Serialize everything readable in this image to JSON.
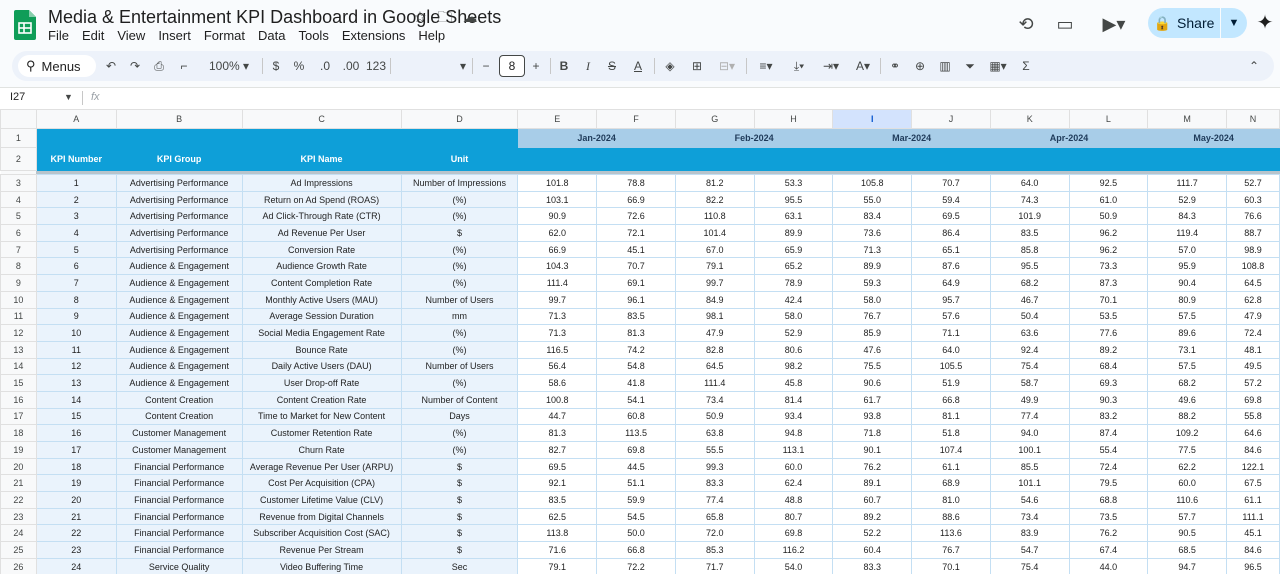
{
  "doc": {
    "title": "Media & Entertainment KPI Dashboard in Google Sheets",
    "menus": [
      "File",
      "Edit",
      "View",
      "Insert",
      "Format",
      "Data",
      "Tools",
      "Extensions",
      "Help"
    ],
    "share_label": "Share"
  },
  "toolbar": {
    "search_label": "Menus",
    "zoom": "100%",
    "currency": "$",
    "percent": "%",
    "dec_decrease": ".0",
    "dec_increase": ".00",
    "format_123": "123",
    "font_size": "8",
    "bold": "B",
    "strike": "S",
    "text_color": "A",
    "minus": "−",
    "plus": "+"
  },
  "formula_bar": {
    "cell_ref": "I27",
    "fx": "fx"
  },
  "columns": [
    "A",
    "B",
    "C",
    "D",
    "E",
    "F",
    "G",
    "H",
    "I",
    "J",
    "K",
    "L",
    "M",
    "N"
  ],
  "selected_column": "I",
  "header_row1": {
    "months": [
      "Jan-2024",
      "Feb-2024",
      "Mar-2024",
      "Apr-2024",
      "May-2024"
    ]
  },
  "header_row2": [
    "KPI Number",
    "KPI Group",
    "KPI Name",
    "Unit"
  ],
  "rows": [
    {
      "n": "3",
      "kpi": "1",
      "group": "Advertising Performance",
      "name": "Ad Impressions",
      "unit": "Number of Impressions",
      "v": [
        "101.8",
        "78.8",
        "81.2",
        "53.3",
        "105.8",
        "70.7",
        "64.0",
        "92.5",
        "111.7",
        "52.7"
      ]
    },
    {
      "n": "4",
      "kpi": "2",
      "group": "Advertising Performance",
      "name": "Return on Ad Spend (ROAS)",
      "unit": "(%)",
      "v": [
        "103.1",
        "66.9",
        "82.2",
        "95.5",
        "55.0",
        "59.4",
        "74.3",
        "61.0",
        "52.9",
        "60.3"
      ]
    },
    {
      "n": "5",
      "kpi": "3",
      "group": "Advertising Performance",
      "name": "Ad Click-Through Rate (CTR)",
      "unit": "(%)",
      "v": [
        "90.9",
        "72.6",
        "110.8",
        "63.1",
        "83.4",
        "69.5",
        "101.9",
        "50.9",
        "84.3",
        "76.6"
      ]
    },
    {
      "n": "6",
      "kpi": "4",
      "group": "Advertising Performance",
      "name": "Ad Revenue Per User",
      "unit": "$",
      "v": [
        "62.0",
        "72.1",
        "101.4",
        "89.9",
        "73.6",
        "86.4",
        "83.5",
        "96.2",
        "119.4",
        "88.7"
      ]
    },
    {
      "n": "7",
      "kpi": "5",
      "group": "Advertising Performance",
      "name": "Conversion Rate",
      "unit": "(%)",
      "v": [
        "66.9",
        "45.1",
        "67.0",
        "65.9",
        "71.3",
        "65.1",
        "85.8",
        "96.2",
        "57.0",
        "98.9"
      ]
    },
    {
      "n": "8",
      "kpi": "6",
      "group": "Audience & Engagement",
      "name": "Audience Growth Rate",
      "unit": "(%)",
      "v": [
        "104.3",
        "70.7",
        "79.1",
        "65.2",
        "89.9",
        "87.6",
        "95.5",
        "73.3",
        "95.9",
        "108.8"
      ]
    },
    {
      "n": "9",
      "kpi": "7",
      "group": "Audience & Engagement",
      "name": "Content Completion Rate",
      "unit": "(%)",
      "v": [
        "111.4",
        "69.1",
        "99.7",
        "78.9",
        "59.3",
        "64.9",
        "68.2",
        "87.3",
        "90.4",
        "64.5"
      ]
    },
    {
      "n": "10",
      "kpi": "8",
      "group": "Audience & Engagement",
      "name": "Monthly Active Users (MAU)",
      "unit": "Number of Users",
      "v": [
        "99.7",
        "96.1",
        "84.9",
        "42.4",
        "58.0",
        "95.7",
        "46.7",
        "70.1",
        "80.9",
        "62.8"
      ]
    },
    {
      "n": "11",
      "kpi": "9",
      "group": "Audience & Engagement",
      "name": "Average Session Duration",
      "unit": "mm",
      "v": [
        "71.3",
        "83.5",
        "98.1",
        "58.0",
        "76.7",
        "57.6",
        "50.4",
        "53.5",
        "57.5",
        "47.9"
      ]
    },
    {
      "n": "12",
      "kpi": "10",
      "group": "Audience & Engagement",
      "name": "Social Media Engagement Rate",
      "unit": "(%)",
      "v": [
        "71.3",
        "81.3",
        "47.9",
        "52.9",
        "85.9",
        "71.1",
        "63.6",
        "77.6",
        "89.6",
        "72.4"
      ]
    },
    {
      "n": "13",
      "kpi": "11",
      "group": "Audience & Engagement",
      "name": "Bounce Rate",
      "unit": "(%)",
      "v": [
        "116.5",
        "74.2",
        "82.8",
        "80.6",
        "47.6",
        "64.0",
        "92.4",
        "89.2",
        "73.1",
        "48.1"
      ]
    },
    {
      "n": "14",
      "kpi": "12",
      "group": "Audience & Engagement",
      "name": "Daily Active Users (DAU)",
      "unit": "Number of Users",
      "v": [
        "56.4",
        "54.8",
        "64.5",
        "98.2",
        "75.5",
        "105.5",
        "75.4",
        "68.4",
        "57.5",
        "49.5"
      ]
    },
    {
      "n": "15",
      "kpi": "13",
      "group": "Audience & Engagement",
      "name": "User Drop-off Rate",
      "unit": "(%)",
      "v": [
        "58.6",
        "41.8",
        "111.4",
        "45.8",
        "90.6",
        "51.9",
        "58.7",
        "69.3",
        "68.2",
        "57.2"
      ]
    },
    {
      "n": "16",
      "kpi": "14",
      "group": "Content Creation",
      "name": "Content Creation Rate",
      "unit": "Number of  Content",
      "v": [
        "100.8",
        "54.1",
        "73.4",
        "81.4",
        "61.7",
        "66.8",
        "49.9",
        "90.3",
        "49.6",
        "69.8"
      ]
    },
    {
      "n": "17",
      "kpi": "15",
      "group": "Content Creation",
      "name": "Time to Market for New Content",
      "unit": "Days",
      "v": [
        "44.7",
        "60.8",
        "50.9",
        "93.4",
        "93.8",
        "81.1",
        "77.4",
        "83.2",
        "88.2",
        "55.8"
      ]
    },
    {
      "n": "18",
      "kpi": "16",
      "group": "Customer Management",
      "name": "Customer Retention Rate",
      "unit": "(%)",
      "v": [
        "81.3",
        "113.5",
        "63.8",
        "94.8",
        "71.8",
        "51.8",
        "94.0",
        "87.4",
        "109.2",
        "64.6"
      ]
    },
    {
      "n": "19",
      "kpi": "17",
      "group": "Customer Management",
      "name": "Churn Rate",
      "unit": "(%)",
      "v": [
        "82.7",
        "69.8",
        "55.5",
        "113.1",
        "90.1",
        "107.4",
        "100.1",
        "55.4",
        "77.5",
        "84.6"
      ]
    },
    {
      "n": "20",
      "kpi": "18",
      "group": "Financial Performance",
      "name": "Average Revenue Per User (ARPU)",
      "unit": "$",
      "v": [
        "69.5",
        "44.5",
        "99.3",
        "60.0",
        "76.2",
        "61.1",
        "85.5",
        "72.4",
        "62.2",
        "122.1"
      ]
    },
    {
      "n": "21",
      "kpi": "19",
      "group": "Financial Performance",
      "name": "Cost Per Acquisition (CPA)",
      "unit": "$",
      "v": [
        "92.1",
        "51.1",
        "83.3",
        "62.4",
        "89.1",
        "68.9",
        "101.1",
        "79.5",
        "60.0",
        "67.5"
      ]
    },
    {
      "n": "22",
      "kpi": "20",
      "group": "Financial Performance",
      "name": "Customer Lifetime Value (CLV)",
      "unit": "$",
      "v": [
        "83.5",
        "59.9",
        "77.4",
        "48.8",
        "60.7",
        "81.0",
        "54.6",
        "68.8",
        "110.6",
        "61.1"
      ]
    },
    {
      "n": "23",
      "kpi": "21",
      "group": "Financial Performance",
      "name": "Revenue from Digital Channels",
      "unit": "$",
      "v": [
        "62.5",
        "54.5",
        "65.8",
        "80.7",
        "89.2",
        "88.6",
        "73.4",
        "73.5",
        "57.7",
        "111.1"
      ]
    },
    {
      "n": "24",
      "kpi": "22",
      "group": "Financial Performance",
      "name": "Subscriber Acquisition Cost (SAC)",
      "unit": "$",
      "v": [
        "113.8",
        "50.0",
        "72.0",
        "69.8",
        "52.2",
        "113.6",
        "83.9",
        "76.2",
        "90.5",
        "45.1"
      ]
    },
    {
      "n": "25",
      "kpi": "23",
      "group": "Financial Performance",
      "name": "Revenue Per Stream",
      "unit": "$",
      "v": [
        "71.6",
        "66.8",
        "85.3",
        "116.2",
        "60.4",
        "76.7",
        "54.7",
        "67.4",
        "68.5",
        "84.6"
      ]
    },
    {
      "n": "26",
      "kpi": "24",
      "group": "Service Quality",
      "name": "Video Buffering Time",
      "unit": "Sec",
      "v": [
        "79.1",
        "72.2",
        "71.7",
        "54.0",
        "83.3",
        "70.1",
        "75.4",
        "44.0",
        "94.7",
        "96.5"
      ]
    }
  ]
}
